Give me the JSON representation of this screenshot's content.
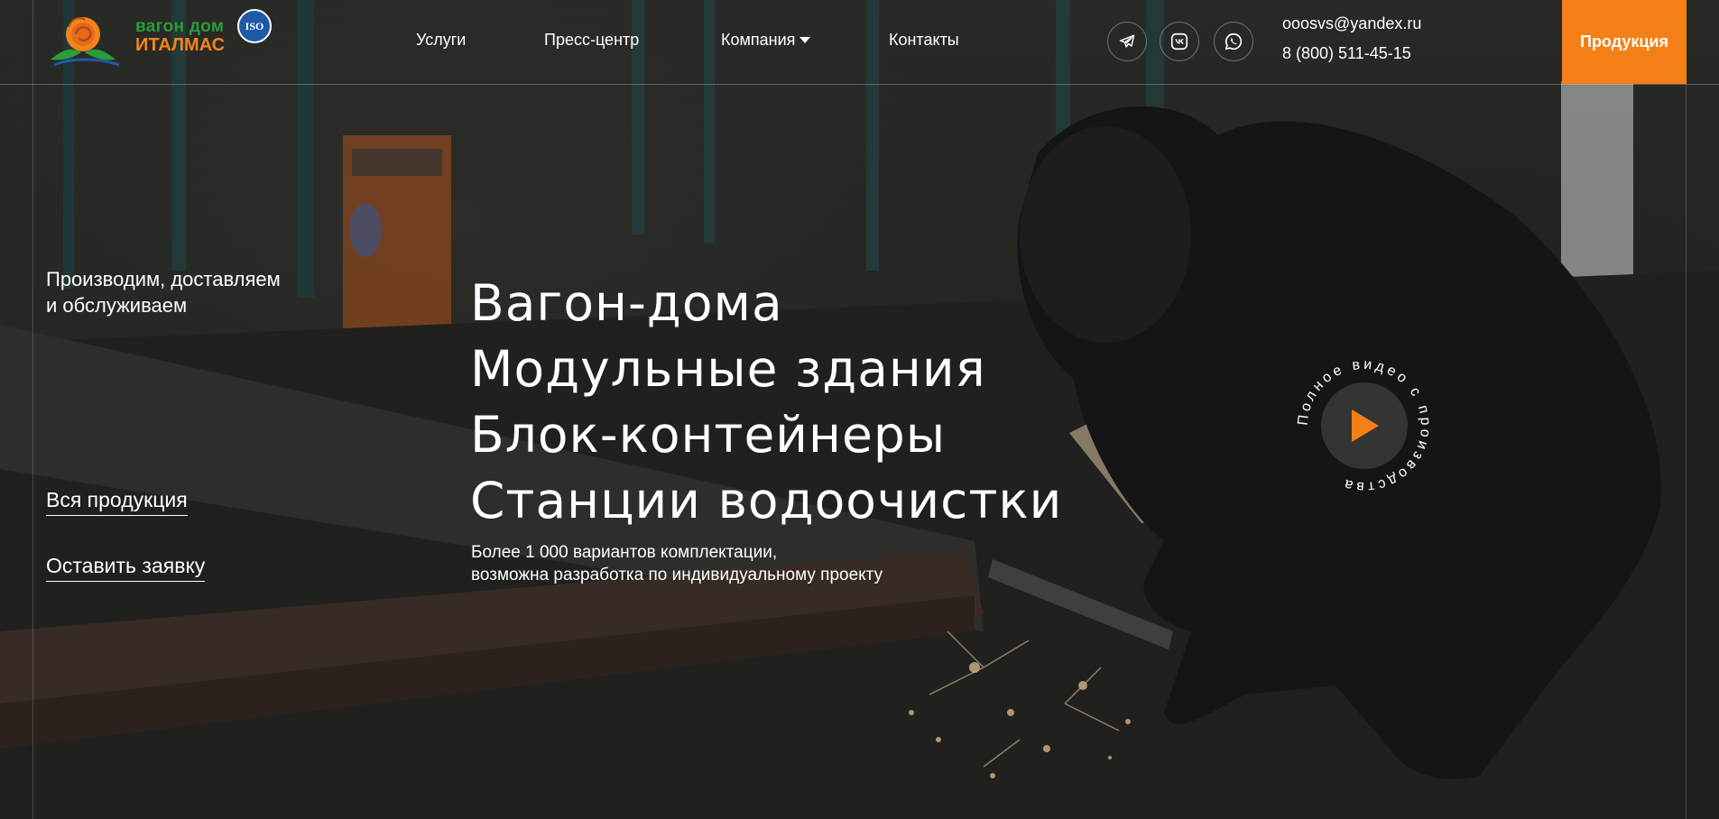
{
  "brand": {
    "logo_line1": "вагон дом",
    "logo_line2": "ИТАЛМАС",
    "iso_label": "ISO",
    "green": "#2c9b3a",
    "orange": "#f3841b"
  },
  "nav": {
    "items": [
      {
        "label": "Услуги"
      },
      {
        "label": "Пресс-центр"
      },
      {
        "label": "Компания"
      },
      {
        "label": "Контакты"
      }
    ]
  },
  "social": {
    "icons": [
      "telegram-icon",
      "vk-icon",
      "whatsapp-icon"
    ]
  },
  "contacts": {
    "email": "ooosvs@yandex.ru",
    "phone": "8 (800) 511-45-15"
  },
  "header_cta": {
    "label": "Продукция",
    "color": "#f57f17"
  },
  "hero": {
    "tagline_line1": "Производим, доставляем",
    "tagline_line2": "и обслуживаем",
    "links": [
      {
        "label": "Вся продукция"
      },
      {
        "label": "Оставить заявку"
      }
    ],
    "headline": [
      "Вагон-дома",
      "Модульные здания",
      "Блок-контейнеры",
      "Станции водоочистки"
    ],
    "subtext_line1": "Более 1 000 вариантов комплектации,",
    "subtext_line2": "возможна разработка по индивидуальному проекту"
  },
  "video": {
    "ring_text": "Полное видео с производства",
    "icon": "play-icon",
    "accent": "#f57f17"
  }
}
